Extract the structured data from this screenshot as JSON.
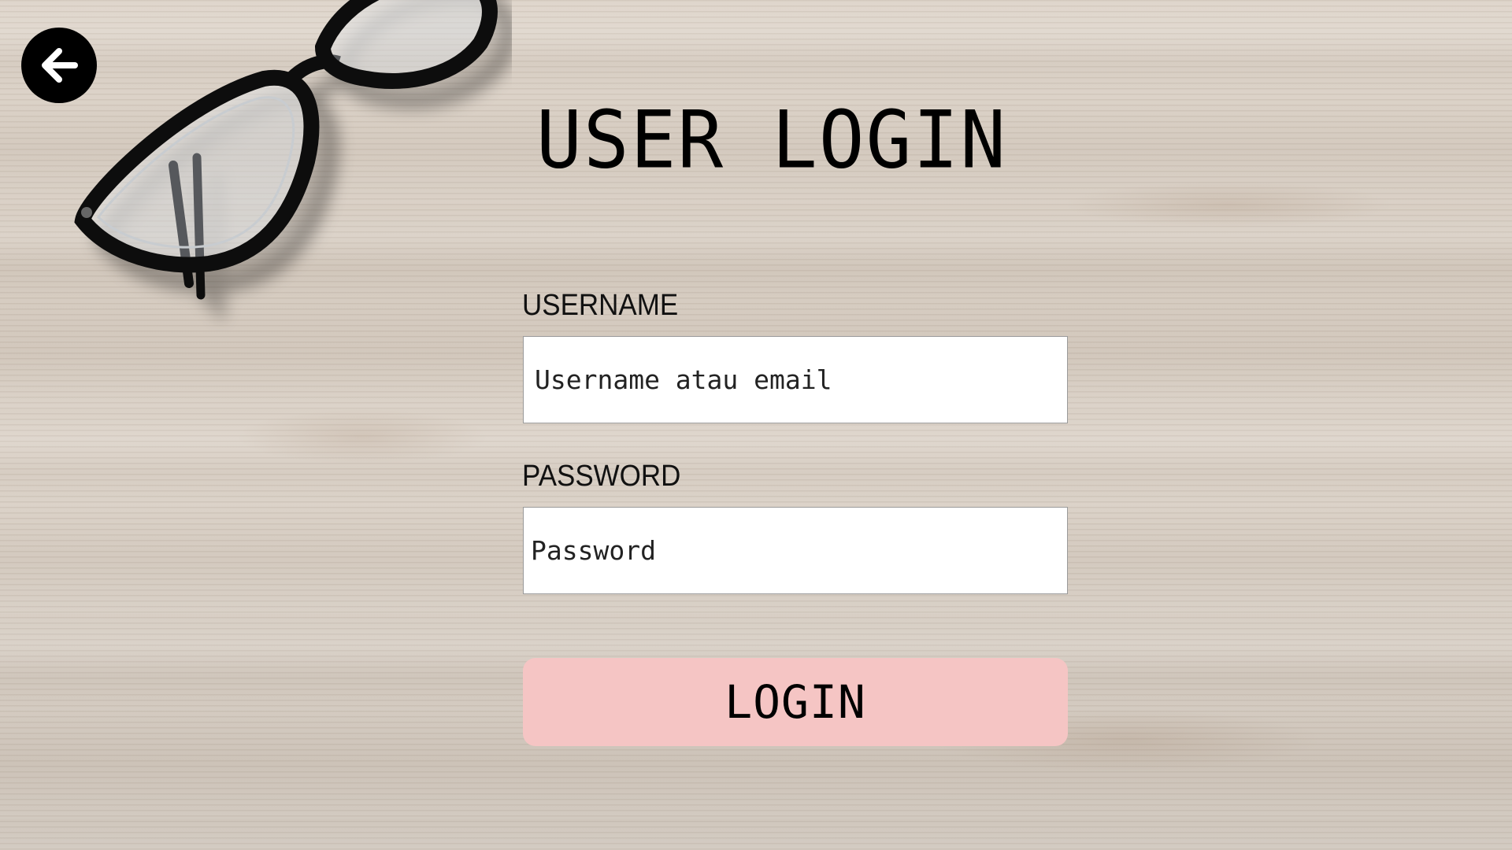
{
  "header": {
    "title": "USER LOGIN",
    "back_icon": "arrow-left-icon"
  },
  "form": {
    "username": {
      "label": "USERNAME",
      "placeholder": "Username atau email",
      "value": ""
    },
    "password": {
      "label": "PASSWORD",
      "placeholder": "Password",
      "value": ""
    },
    "submit_label": "LOGIN"
  },
  "theme": {
    "background": "#dcd3c8",
    "back_button_color": "#000000",
    "login_button_color": "#f5c5c4",
    "input_background": "#ffffff"
  }
}
